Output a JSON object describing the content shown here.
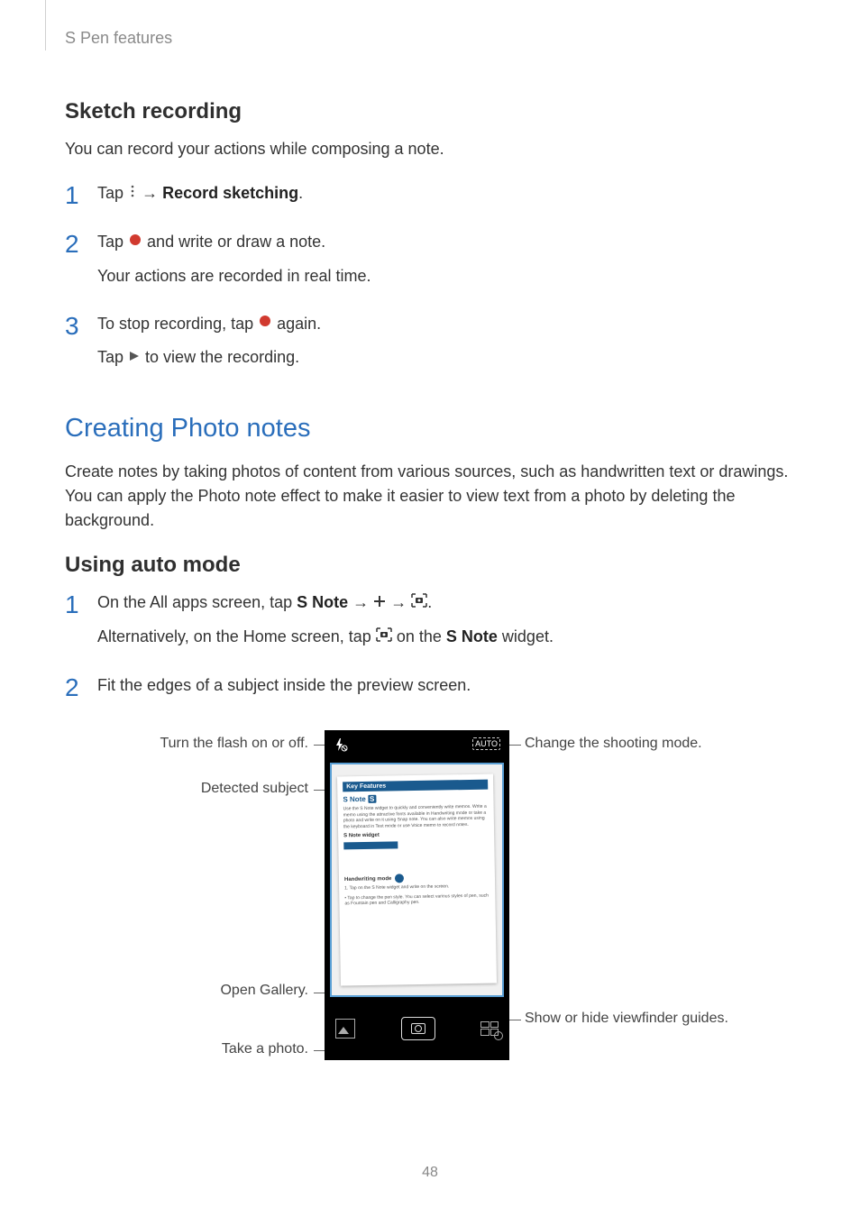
{
  "header": {
    "breadcrumb": "S Pen features"
  },
  "sketch": {
    "heading": "Sketch recording",
    "intro": "You can record your actions while composing a note.",
    "step1": {
      "num": "1",
      "pre": "Tap",
      "arrow": "→",
      "bold": "Record sketching",
      "post": "."
    },
    "step2": {
      "num": "2",
      "line1a": "Tap",
      "line1b": " and write or draw a note.",
      "line2": "Your actions are recorded in real time."
    },
    "step3": {
      "num": "3",
      "line1a": "To stop recording, tap",
      "line1b": " again.",
      "line2a": "Tap",
      "line2b": " to view the recording."
    }
  },
  "photo": {
    "heading": "Creating Photo notes",
    "intro": "Create notes by taking photos of content from various sources, such as handwritten text or drawings. You can apply the Photo note effect to make it easier to view text from a photo by deleting the background.",
    "sub": "Using auto mode",
    "step1": {
      "num": "1",
      "line1a": "On the All apps screen, tap ",
      "snote": "S Note",
      "arrow": " → ",
      "dot": ".",
      "line2a": "Alternatively, on the Home screen, tap ",
      "line2b": " on the ",
      "line2c": " widget."
    },
    "step2": {
      "num": "2",
      "line1": "Fit the edges of a subject inside the preview screen."
    }
  },
  "figure": {
    "callout_flash": "Turn the flash on or off.",
    "callout_subject": "Detected subject",
    "callout_gallery": "Open Gallery.",
    "callout_photo": "Take a photo.",
    "callout_mode": "Change the shooting mode.",
    "callout_guides": "Show or hide viewfinder guides.",
    "auto_label": "AUTO",
    "doc_header": "Key Features",
    "doc_title_a": "S Note",
    "doc_title_b": "S",
    "doc_p1": "Use the S Note widget to quickly and conveniently write memos. Write a memo using the attractive fonts available in Handwriting mode or take a photo and write on it using Snap note. You can also write memos using the keyboard in Text mode or use Voice memo to record notes.",
    "doc_sub1": "S Note widget",
    "doc_sub2": "Handwriting mode",
    "doc_p2": "1. Tap on the S Note widget and write on the screen.",
    "doc_p3": "• Tap to change the pen style. You can select various styles of pen, such as Fountain pen and Calligraphy pen."
  },
  "page_number": "48"
}
